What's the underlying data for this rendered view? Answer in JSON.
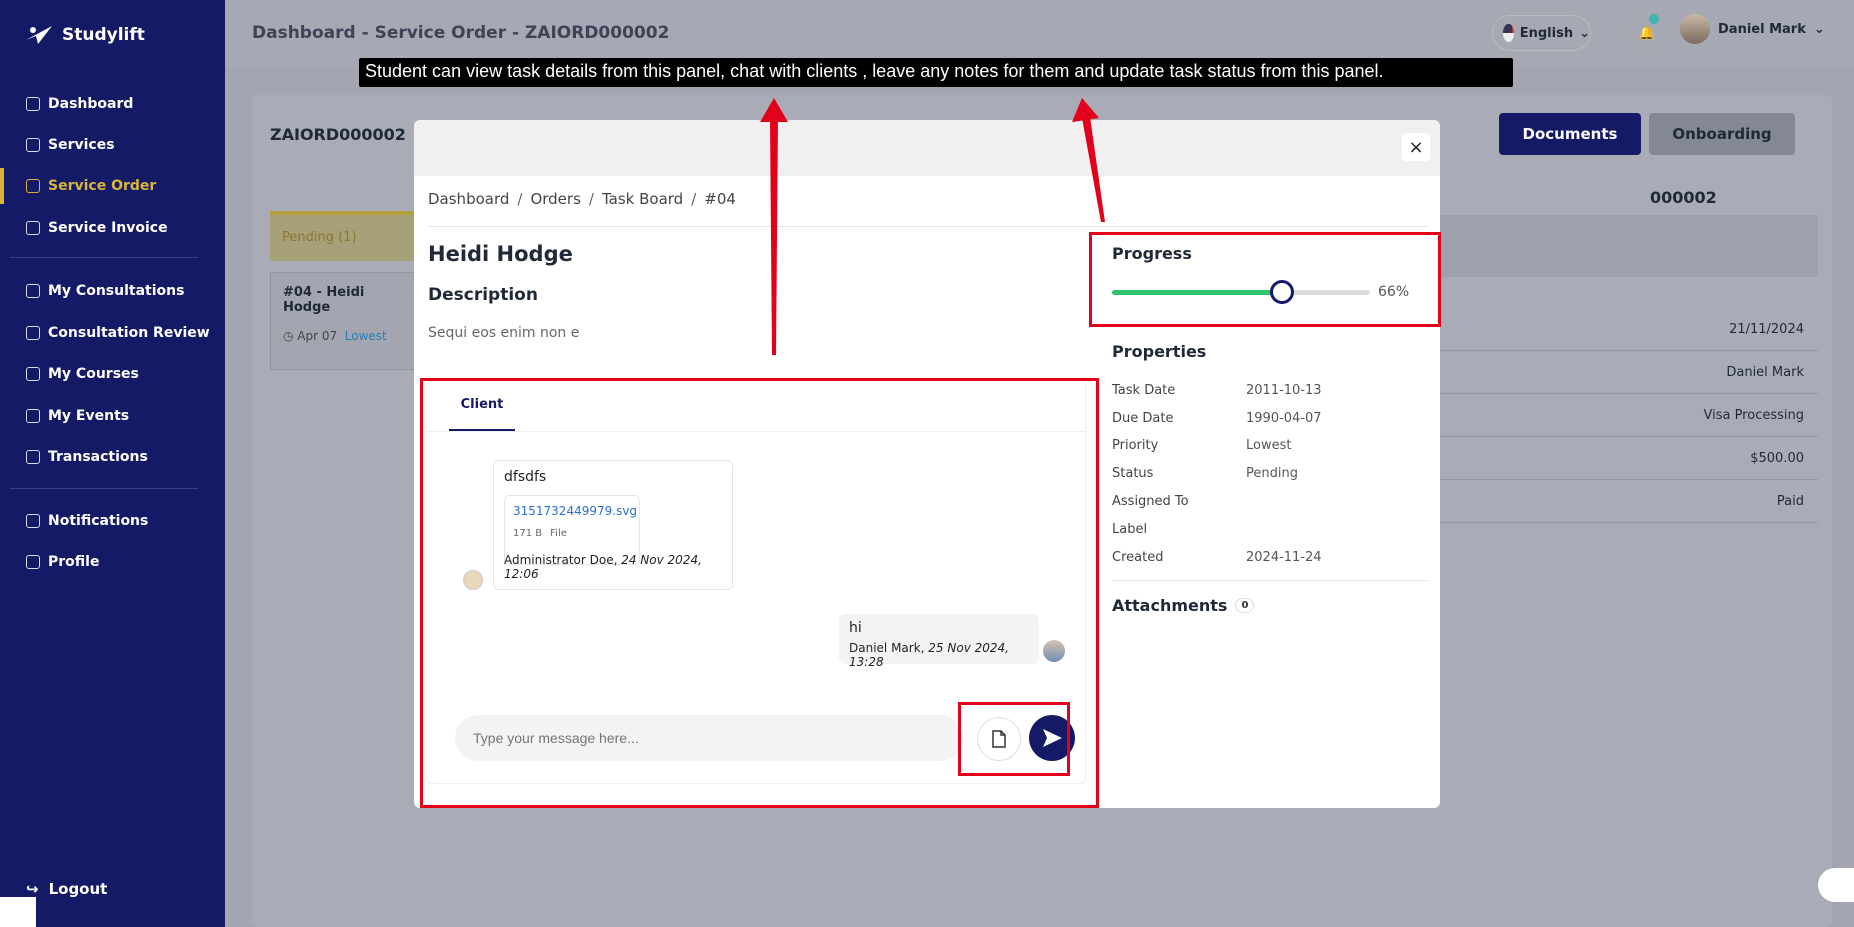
{
  "app": {
    "name": "Studylift"
  },
  "sidebar": {
    "items": [
      {
        "label": "Dashboard"
      },
      {
        "label": "Services"
      },
      {
        "label": "Service Order"
      },
      {
        "label": "Service Invoice"
      },
      {
        "label": "My Consultations"
      },
      {
        "label": "Consultation Review"
      },
      {
        "label": "My Courses"
      },
      {
        "label": "My Events"
      },
      {
        "label": "Transactions"
      },
      {
        "label": "Notifications"
      },
      {
        "label": "Profile"
      }
    ],
    "logout": "Logout"
  },
  "header": {
    "breadcrumb": "Dashboard  -  Service Order  -  ZAIORD000002",
    "language": "English",
    "user": "Daniel Mark"
  },
  "background": {
    "order_id": "ZAIORD000002",
    "documents_button": "Documents",
    "onboarding_button": "Onboarding",
    "pending_label": "Pending (1)",
    "task_card": {
      "title": "#04 - Heidi Hodge",
      "date": "Apr 07",
      "priority": "Lowest"
    },
    "order_ref": "000002",
    "table": [
      "21/11/2024",
      "Daniel Mark",
      "Visa Processing",
      "$500.00",
      "Paid"
    ]
  },
  "modal": {
    "close": "×",
    "breadcrumb": [
      "Dashboard",
      "Orders",
      "Task Board",
      "#04"
    ],
    "title": "Heidi Hodge",
    "description_heading": "Description",
    "description": "Sequi eos enim non e",
    "chat": {
      "tab": "Client",
      "messages": [
        {
          "text": "dfsdfs",
          "file": {
            "name": "3151732449979.svg",
            "size": "171 B",
            "type": "File"
          },
          "author": "Administrator Doe, ",
          "time": "24 Nov 2024, 12:06"
        },
        {
          "text": "hi",
          "author": "Daniel Mark, ",
          "time": "25 Nov 2024, 13:28"
        }
      ],
      "placeholder": "Type your message here..."
    },
    "progress": {
      "heading": "Progress",
      "value": 0.66,
      "label": "66%"
    },
    "properties": {
      "heading": "Properties",
      "rows": [
        {
          "key": "Task Date",
          "value": "2011-10-13"
        },
        {
          "key": "Due Date",
          "value": "1990-04-07"
        },
        {
          "key": "Priority",
          "value": "Lowest"
        },
        {
          "key": "Status",
          "value": "Pending"
        },
        {
          "key": "Assigned To",
          "value": ""
        },
        {
          "key": "Label",
          "value": ""
        },
        {
          "key": "Created",
          "value": "2024-11-24"
        }
      ]
    },
    "attachments": {
      "heading": "Attachments",
      "count": "0"
    }
  },
  "annotation": {
    "tooltip": "Student can view task details from this panel, chat with clients , leave any notes for them and update task status from this panel.",
    "color": "#e3001b"
  },
  "colors": {
    "sidebar": "#151a66",
    "active": "#d8b53a",
    "progress": "#2dc46a"
  }
}
